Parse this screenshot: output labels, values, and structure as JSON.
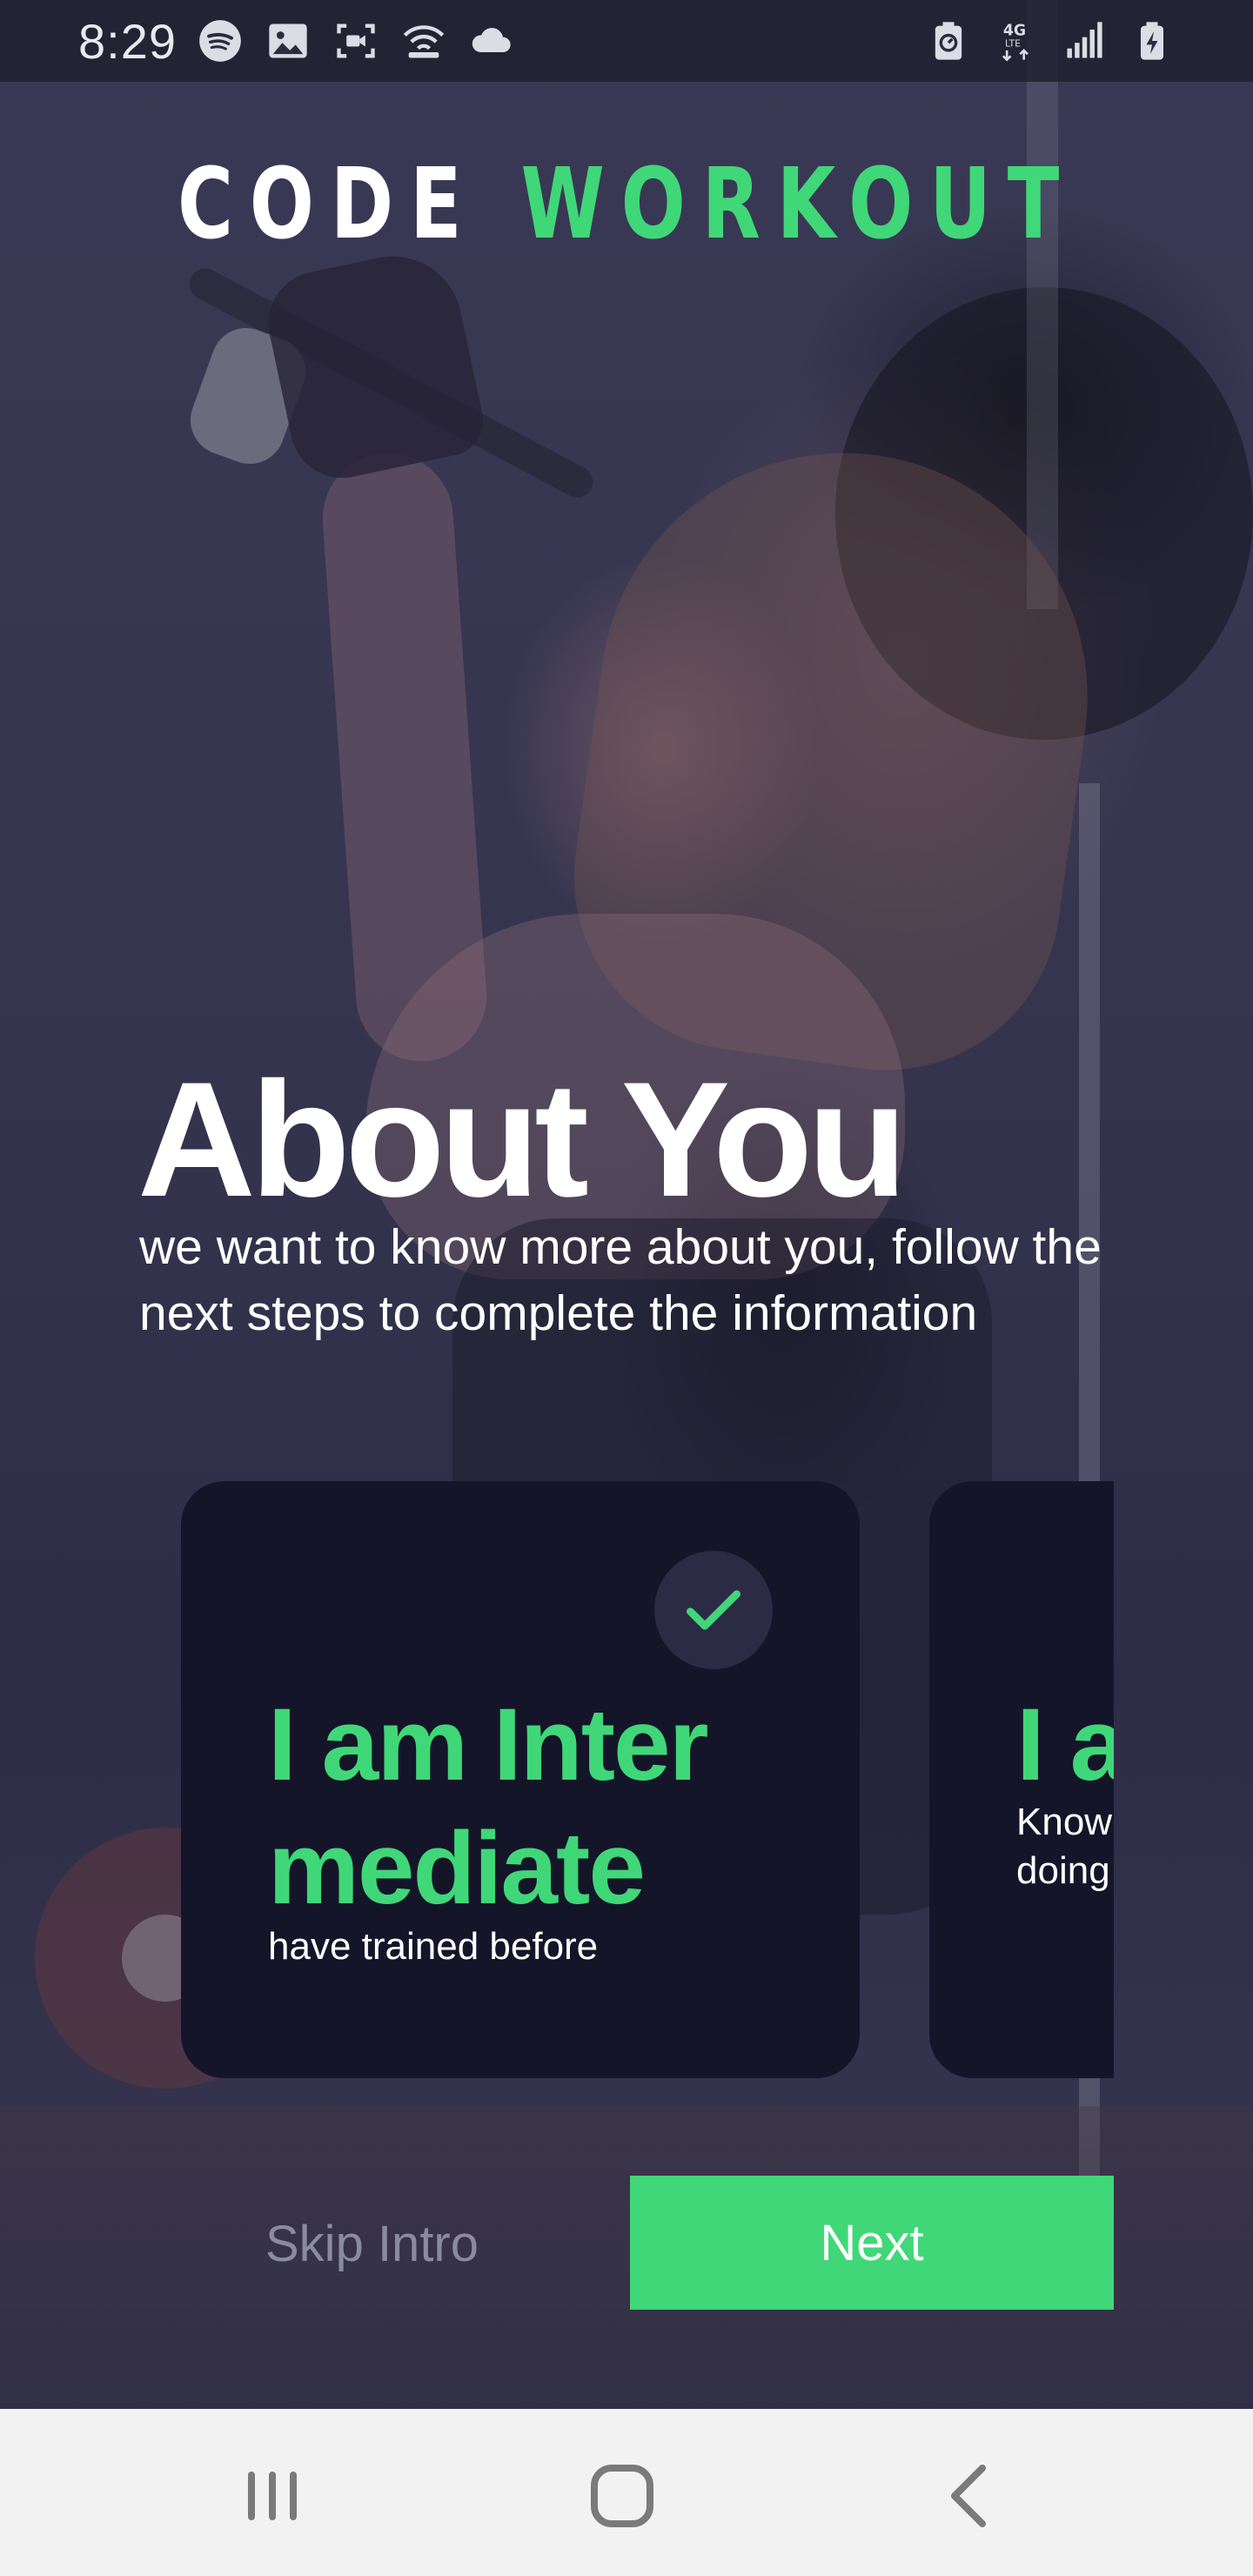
{
  "status_bar": {
    "time": "8:29",
    "left_icons": [
      "spotify-icon",
      "gallery-icon",
      "screen-record-icon",
      "wifi-hotspot-icon",
      "cloud-icon"
    ],
    "right_icons": [
      "battery-saver-icon",
      "lte-4g-icon",
      "signal-icon",
      "battery-charging-icon"
    ]
  },
  "app": {
    "logo_part1": "CODE",
    "logo_part2": "WORKOUT",
    "title": "About You",
    "subtitle": "we want to know more about you, follow the next steps   to complete the information"
  },
  "cards": [
    {
      "title": "I am Inter mediate",
      "subtitle": "have trained before",
      "selected": true
    },
    {
      "title": "I a",
      "subtitle": "Know\ndoing",
      "selected": false
    }
  ],
  "actions": {
    "skip_label": "Skip Intro",
    "next_label": "Next"
  },
  "nav_bar": {
    "buttons": [
      "recents-icon",
      "home-icon",
      "back-icon"
    ]
  },
  "colors": {
    "accent": "#40d778",
    "card_bg": "#15152a",
    "overlay": "#2c2b45",
    "skip_text": "#8a8aa0",
    "nav_bg": "#f2f2f2"
  }
}
